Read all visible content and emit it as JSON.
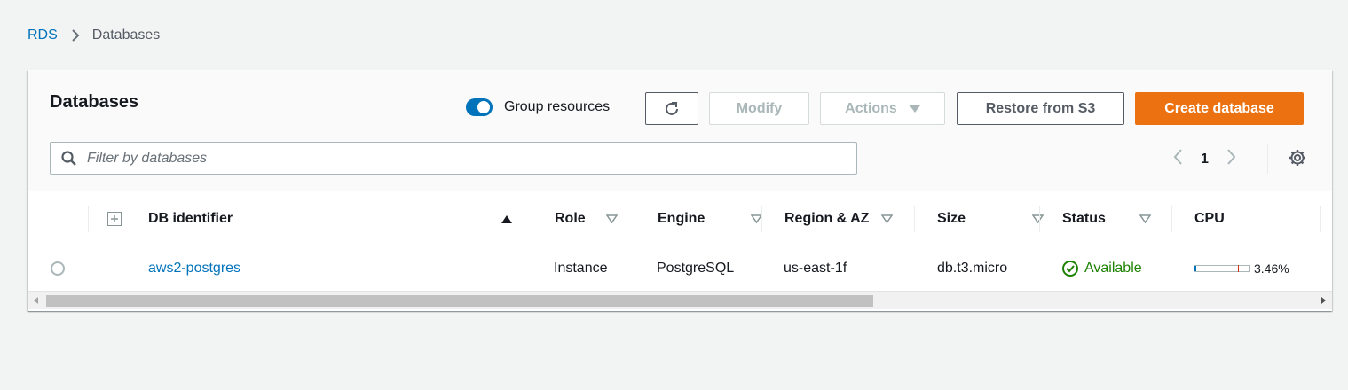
{
  "breadcrumb": {
    "root": "RDS",
    "current": "Databases"
  },
  "header": {
    "title": "Databases",
    "group_resources_label": "Group resources",
    "group_resources_on": true,
    "modify_label": "Modify",
    "actions_label": "Actions",
    "restore_label": "Restore from S3",
    "create_label": "Create database"
  },
  "filter": {
    "placeholder": "Filter by databases",
    "value": ""
  },
  "pagination": {
    "current_page": "1"
  },
  "table": {
    "columns": [
      "DB identifier",
      "Role",
      "Engine",
      "Region & AZ",
      "Size",
      "Status",
      "CPU"
    ],
    "rows": [
      {
        "db_identifier": "aws2-postgres",
        "role": "Instance",
        "engine": "PostgreSQL",
        "region_az": "us-east-1f",
        "size": "db.t3.micro",
        "status": "Available",
        "cpu": "3.46%",
        "cpu_fraction": 0.0346
      }
    ]
  },
  "colors": {
    "link": "#0073bb",
    "primary_button": "#ec7211",
    "status_available": "#1d8102",
    "toggle_on": "#0073bb"
  }
}
